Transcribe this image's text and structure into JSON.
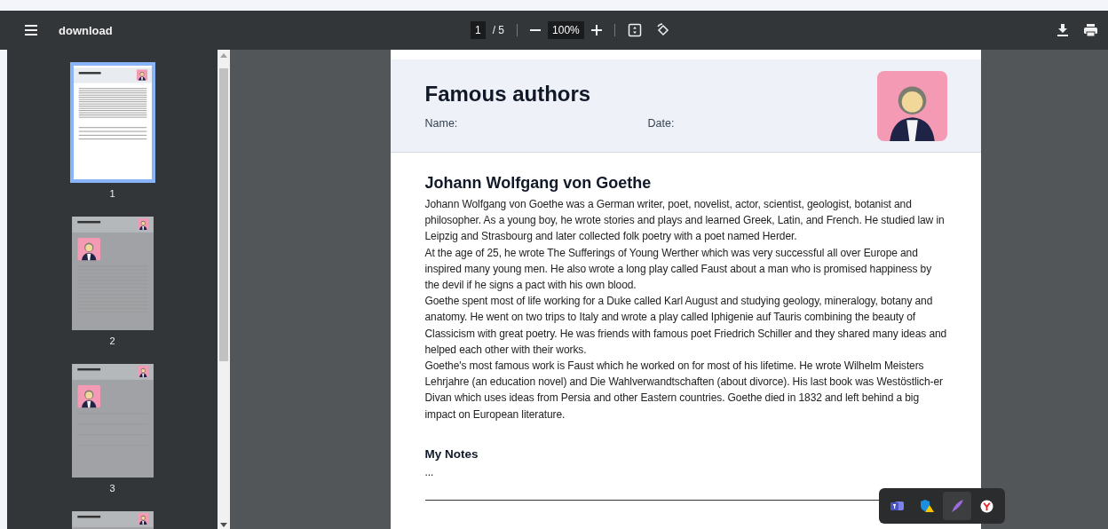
{
  "toolbar": {
    "title": "download",
    "page_current": "1",
    "page_total": "/ 5",
    "zoom": "100%"
  },
  "thumbnails": [
    {
      "label": "1",
      "selected": true,
      "kind": "text"
    },
    {
      "label": "2",
      "selected": false,
      "kind": "profile"
    },
    {
      "label": "3",
      "selected": false,
      "kind": "form"
    },
    {
      "selected": false,
      "kind": "profile"
    }
  ],
  "document": {
    "title": "Famous authors",
    "name_label": "Name:",
    "date_label": "Date:",
    "heading": "Johann Wolfgang von Goethe",
    "paragraphs": [
      "Johann Wolfgang von Goethe was a German writer, poet, novelist, actor, scientist, geologist, botanist and philosopher. As a young boy, he wrote stories and plays and learned Greek, Latin, and French. He studied law in Leipzig and Strasbourg and later collected folk poetry with a poet named Herder.",
      "At the age of 25, he wrote The Sufferings of Young Werther which was very successful all over Europe and inspired many young men. He also wrote a long play called Faust about a man who is promised happiness by the devil if he signs a pact with his own blood.",
      "Goethe spent most of life working for a Duke called Karl August and studying geology, mineralogy, botany and anatomy. He went on two trips to Italy and wrote a play called Iphigenie auf Tauris combining the beauty of Classicism with great poetry. He was friends with famous poet Friedrich Schiller and they shared many ideas and helped each other with their works.",
      "Goethe's most famous work is Faust which he worked on for most of his lifetime. He wrote Wilhelm Meisters Lehrjahre (an education novel) and Die Wahlverwandtschaften (about divorce). His last book was Westöstlich-er Divan which uses ideas from Persia and other Eastern countries. Goethe died in 1832 and left behind a big impact on European literature."
    ],
    "notes_heading": "My Notes",
    "notes_text": "..."
  },
  "tray": [
    {
      "kind": "teams",
      "selected": false
    },
    {
      "kind": "shield",
      "selected": false
    },
    {
      "kind": "feather",
      "selected": true
    },
    {
      "kind": "browser",
      "selected": false
    }
  ]
}
